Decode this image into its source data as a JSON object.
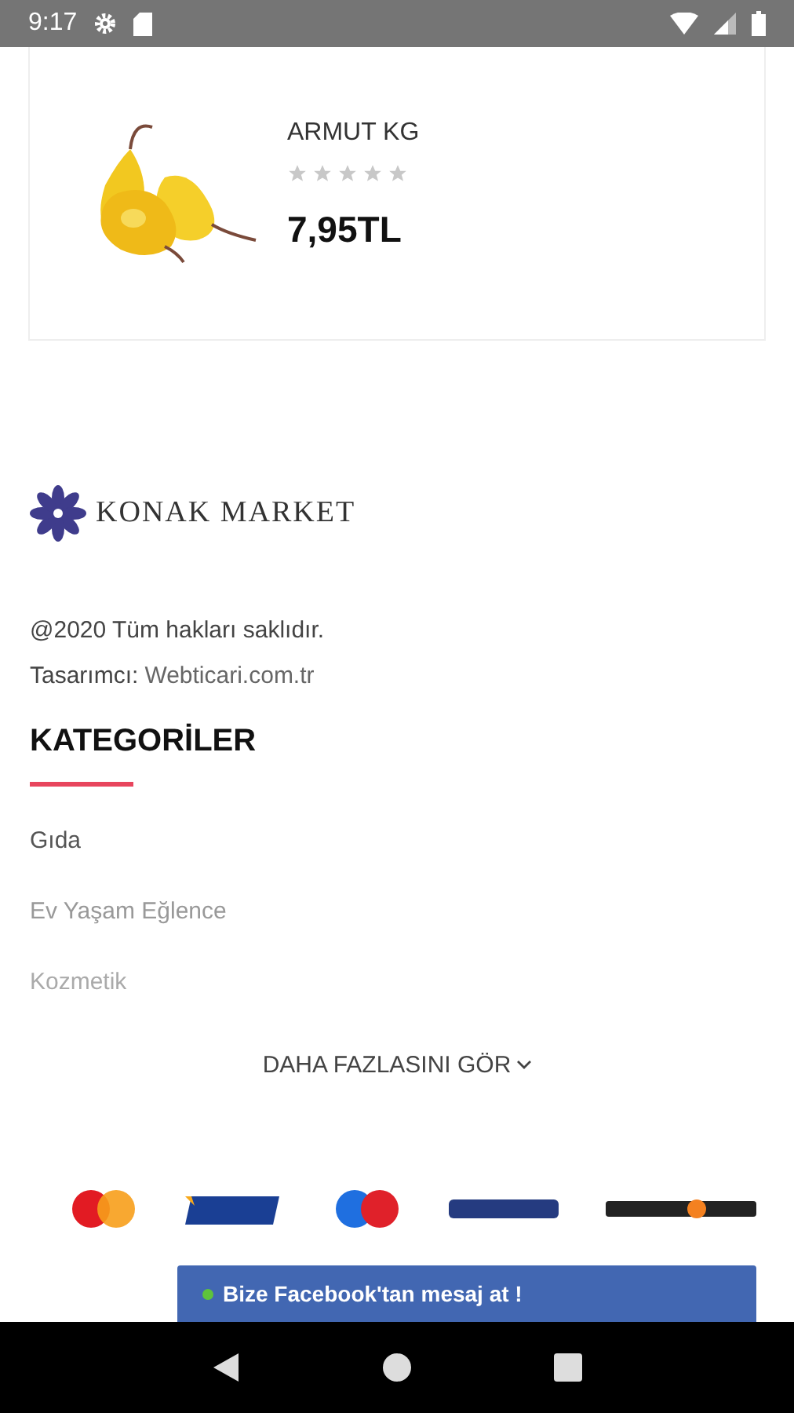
{
  "status_bar": {
    "time": "9:17"
  },
  "product": {
    "name": "ARMUT KG",
    "stars": 0,
    "price": "7,95TL"
  },
  "footer": {
    "brand": "KONAK MARKET",
    "copyright": "@2020 Tüm hakları saklıdır.",
    "designer_label": "Tasarımcı:",
    "designer_link": "Webticari.com.tr"
  },
  "categories": {
    "title": "KATEGORİLER",
    "items": [
      {
        "label": "Gıda"
      },
      {
        "label": "Ev Yaşam Eğlence"
      },
      {
        "label": "Kozmetik"
      }
    ],
    "more": "DAHA FAZLASINI GÖR"
  },
  "chat_bar": {
    "label": "Bize Facebook'tan mesaj at !",
    "online": true
  }
}
